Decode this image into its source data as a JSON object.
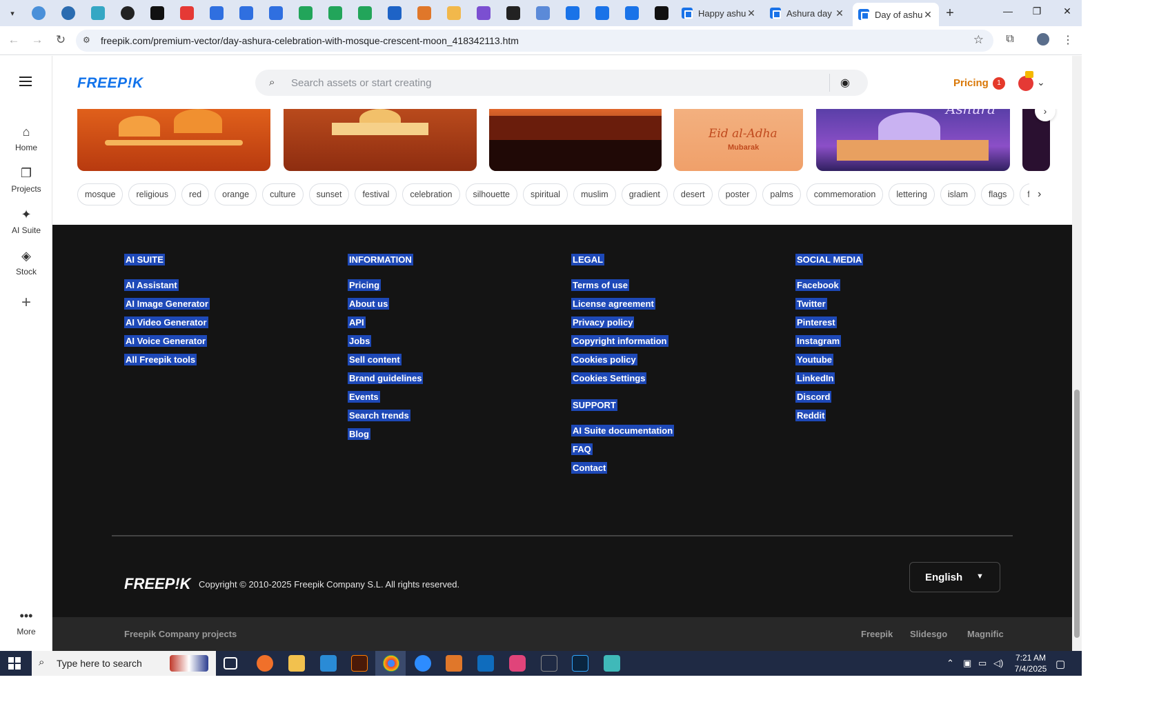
{
  "browser": {
    "tabs": [
      {
        "title": "Happy ashu",
        "active": false
      },
      {
        "title": "Ashura day",
        "active": false
      },
      {
        "title": "Day of ashu",
        "active": true
      }
    ],
    "url": "freepik.com/premium-vector/day-ashura-celebration-with-mosque-crescent-moon_418342113.htm"
  },
  "sidebar": {
    "items": [
      {
        "label": "Home",
        "icon": "home-icon"
      },
      {
        "label": "Projects",
        "icon": "projects-icon"
      },
      {
        "label": "AI Suite",
        "icon": "sparkle-icon"
      },
      {
        "label": "Stock",
        "icon": "stock-icon"
      }
    ],
    "more_label": "More"
  },
  "header": {
    "logo": "FREEP!K",
    "search_placeholder": "Search assets or start creating",
    "pricing_label": "Pricing",
    "notification_count": "1"
  },
  "thumbnails": {
    "eid_title": "Eid al-Adha",
    "eid_sub": "Mubarak",
    "ashura_text": "Ashura"
  },
  "tags": [
    "mosque",
    "religious",
    "red",
    "orange",
    "culture",
    "sunset",
    "festival",
    "celebration",
    "silhouette",
    "spiritual",
    "muslim",
    "gradient",
    "desert",
    "poster",
    "palms",
    "commemoration",
    "lettering",
    "islam",
    "flags",
    "flyer"
  ],
  "footer": {
    "columns": [
      {
        "heading": "AI SUITE",
        "links": [
          "AI Assistant",
          "AI Image Generator",
          "AI Video Generator",
          "AI Voice Generator",
          "All Freepik tools"
        ]
      },
      {
        "heading": "INFORMATION",
        "links": [
          "Pricing",
          "About us",
          "API",
          "Jobs",
          "Sell content",
          "Brand guidelines",
          "Events",
          "Search trends",
          "Blog"
        ]
      },
      {
        "heading": "LEGAL",
        "links": [
          "Terms of use",
          "License agreement",
          "Privacy policy",
          "Copyright information",
          "Cookies policy",
          "Cookies Settings"
        ],
        "heading2": "SUPPORT",
        "links2": [
          "AI Suite documentation",
          "FAQ",
          "Contact"
        ]
      },
      {
        "heading": "SOCIAL MEDIA",
        "links": [
          "Facebook",
          "Twitter",
          "Pinterest",
          "Instagram",
          "Youtube",
          "LinkedIn",
          "Discord",
          "Reddit"
        ]
      }
    ],
    "logo": "FREEP!K",
    "copyright": "Copyright © 2010-2025 Freepik Company S.L. All rights reserved.",
    "language": "English",
    "company_label": "Freepik Company projects",
    "company_links": [
      "Freepik",
      "Slidesgo",
      "Magnific"
    ]
  },
  "taskbar": {
    "search_placeholder": "Type here to search",
    "time": "7:21 AM",
    "date": "7/4/2025"
  }
}
